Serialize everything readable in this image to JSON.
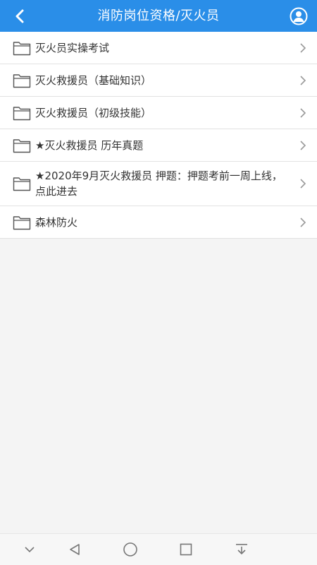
{
  "header": {
    "title": "消防岗位资格/灭火员",
    "back_icon": "chevron-left-icon",
    "user_icon": "user-avatar-icon",
    "background": "#2a8ee8"
  },
  "list": {
    "items": [
      {
        "label": "灭火员实操考试",
        "icon": "folder-icon"
      },
      {
        "label": "灭火救援员（基础知识）",
        "icon": "folder-icon"
      },
      {
        "label": "灭火救援员（初级技能）",
        "icon": "folder-icon"
      },
      {
        "label": "★灭火救援员 历年真题",
        "icon": "folder-icon"
      },
      {
        "label": "★2020年9月灭火救援员 押题：押题考前一周上线，点此进去",
        "icon": "folder-icon"
      },
      {
        "label": "森林防火",
        "icon": "folder-icon"
      }
    ]
  },
  "navbar": {
    "buttons": [
      "collapse-icon",
      "back-triangle-icon",
      "home-circle-icon",
      "recents-square-icon",
      "notification-pull-icon"
    ]
  }
}
